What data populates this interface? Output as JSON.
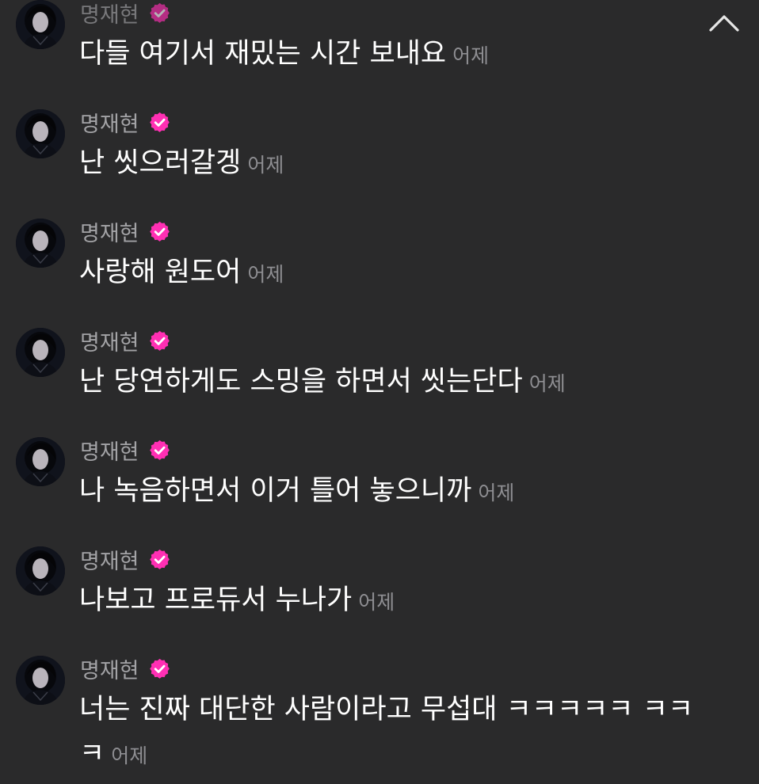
{
  "accent": "#ff2fb3",
  "collapse_icon": "chevron-up-icon",
  "messages": [
    {
      "author": "명재현",
      "text": "다들 여기서 재밌는 시간 보내요",
      "time": "어제"
    },
    {
      "author": "명재현",
      "text": "난 씻으러갈겡",
      "time": "어제"
    },
    {
      "author": "명재현",
      "text": "사랑해 원도어",
      "time": "어제"
    },
    {
      "author": "명재현",
      "text": "난 당연하게도 스밍을 하면서 씻는단다",
      "time": "어제"
    },
    {
      "author": "명재현",
      "text": "나 녹음하면서 이거 틀어 놓으니까",
      "time": "어제"
    },
    {
      "author": "명재현",
      "text": "나보고 프로듀서 누나가",
      "time": "어제"
    },
    {
      "author": "명재현",
      "text": "너는 진짜 대단한 사람이라고 무섭대 ㅋㅋㅋㅋㅋ ㅋㅋㅋ",
      "time": "어제"
    }
  ]
}
